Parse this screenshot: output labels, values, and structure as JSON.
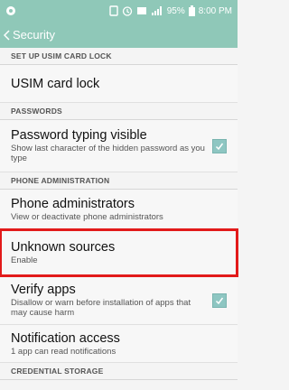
{
  "status_bar": {
    "battery_percent": "95%",
    "time": "8:00 PM"
  },
  "action_bar": {
    "back_icon": "chevron-left-icon",
    "title": "Security"
  },
  "sections": {
    "usim": "SET UP USIM CARD LOCK",
    "passwords": "PASSWORDS",
    "phone_admin": "PHONE ADMINISTRATION",
    "credential_storage": "CREDENTIAL STORAGE"
  },
  "items": {
    "usim_lock": {
      "title": "USIM card lock"
    },
    "password_visible": {
      "title": "Password typing visible",
      "subtitle": "Show last character of the hidden password as you type",
      "checked": true
    },
    "phone_admins": {
      "title": "Phone administrators",
      "subtitle": "View or deactivate phone administrators"
    },
    "unknown_sources": {
      "title": "Unknown sources",
      "subtitle": "Enable"
    },
    "verify_apps": {
      "title": "Verify apps",
      "subtitle": "Disallow or warn before installation of apps that may cause harm",
      "checked": true
    },
    "notification_access": {
      "title": "Notification access",
      "subtitle": "1 app can read notifications"
    }
  },
  "colors": {
    "accent": "#8fc8b8",
    "highlight": "#e21a1a",
    "checkbox": "#8ec6c2"
  }
}
